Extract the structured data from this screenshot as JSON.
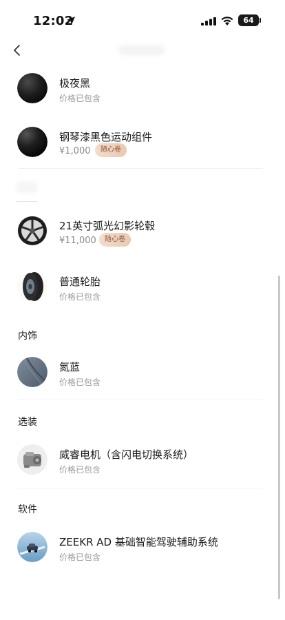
{
  "status": {
    "time": "12:02",
    "battery": "64"
  },
  "items": [
    {
      "title": "极夜黑",
      "sub": "价格已包含",
      "icon": "paint-swatch-black"
    },
    {
      "title": "钢琴漆黑色运动组件",
      "price": "¥1,000",
      "tag": "随心卷",
      "icon": "paint-swatch-gloss-black"
    },
    {
      "title": "21英寸弧光幻影轮毂",
      "price": "¥11,000",
      "tag": "随心卷",
      "icon": "wheel-icon"
    },
    {
      "title": "普通轮胎",
      "sub": "价格已包含",
      "icon": "tire-icon"
    },
    {
      "title": "氮蓝",
      "sub": "价格已包含",
      "icon": "interior-swatch-blue"
    },
    {
      "title": "威睿电机（含闪电切换系统）",
      "sub": "价格已包含",
      "icon": "motor-icon"
    },
    {
      "title": "ZEEKR AD 基础智能驾驶辅助系统",
      "sub": "价格已包含",
      "icon": "driving-assist-icon"
    }
  ],
  "sections": {
    "interior": "内饰",
    "options": "选装",
    "software": "软件"
  },
  "colors": {
    "tag_bg": "#f0d6c4",
    "tag_text": "#8c5a3c"
  }
}
